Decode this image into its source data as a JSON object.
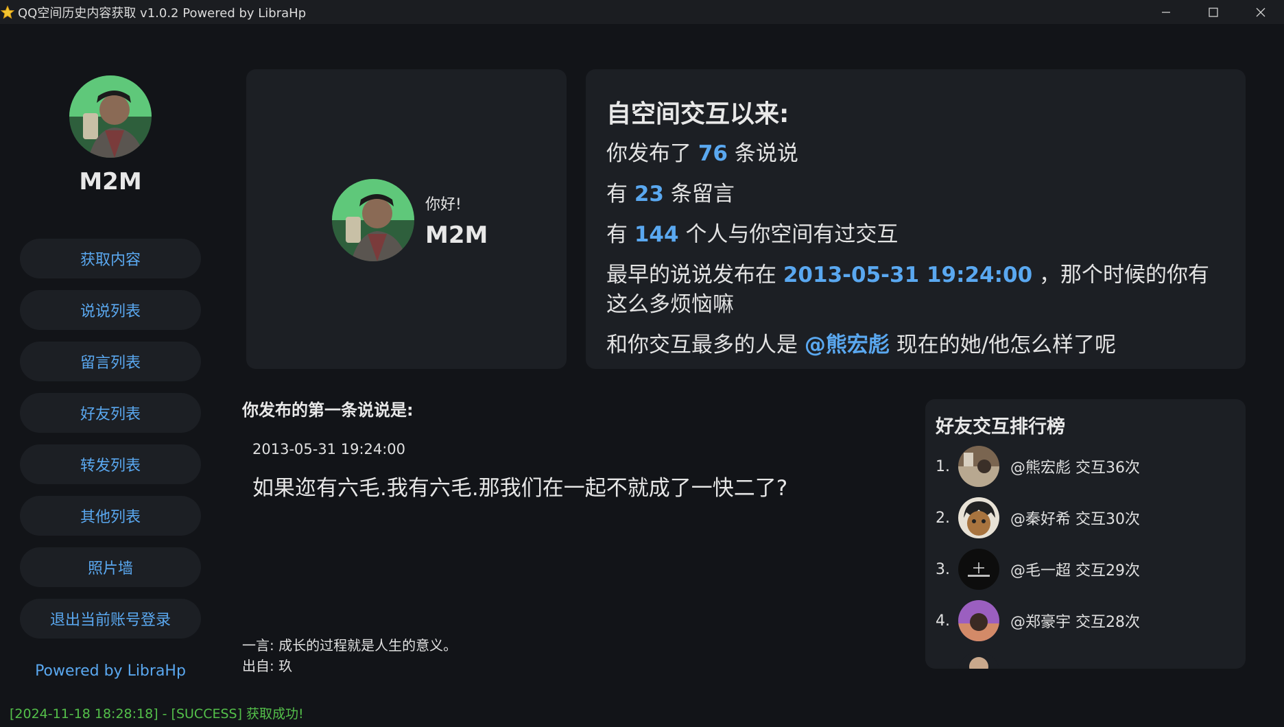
{
  "window": {
    "title": "QQ空间历史内容获取 v1.0.2 Powered by LibraHp"
  },
  "sidebar": {
    "name": "M2M",
    "items": [
      {
        "label": "获取内容"
      },
      {
        "label": "说说列表"
      },
      {
        "label": "留言列表"
      },
      {
        "label": "好友列表"
      },
      {
        "label": "转发列表"
      },
      {
        "label": "其他列表"
      },
      {
        "label": "照片墙"
      },
      {
        "label": "退出当前账号登录"
      }
    ],
    "powered": "Powered by LibraHp"
  },
  "greeting": {
    "hello": "你好!",
    "name": "M2M"
  },
  "stats": {
    "title": "自空间交互以来:",
    "posts_prefix": "你发布了",
    "posts_count": "76",
    "posts_suffix": "条说说",
    "messages_prefix": "有",
    "messages_count": "23",
    "messages_suffix": "条留言",
    "people_prefix": "有",
    "people_count": "144",
    "people_suffix": "个人与你空间有过交互",
    "earliest_prefix": "最早的说说发布在",
    "earliest_time": "2013-05-31 19:24:00",
    "earliest_suffix": "，那个时候的你有这么多烦恼嘛",
    "top_prefix": "和你交互最多的人是",
    "top_friend": "@熊宏彪",
    "top_suffix": "现在的她/他怎么样了呢"
  },
  "first_post": {
    "title": "你发布的第一条说说是:",
    "date": "2013-05-31 19:24:00",
    "content": "如果迩有六毛.我有六毛.那我们在一起不就成了一快二了?"
  },
  "quote": {
    "text": "一言: 成长的过程就是人生的意义。",
    "source": "出自: 玖"
  },
  "ranking": {
    "title": "好友交互排行榜",
    "items": [
      {
        "rank": "1.",
        "text": "@熊宏彪 交互36次"
      },
      {
        "rank": "2.",
        "text": "@秦好希 交互30次"
      },
      {
        "rank": "3.",
        "text": "@毛一超 交互29次"
      },
      {
        "rank": "4.",
        "text": "@郑豪宇 交互28次"
      }
    ]
  },
  "log": "[2024-11-18 18:28:18] - [SUCCESS] 获取成功!",
  "colors": {
    "accent": "#5aa8f0",
    "success": "#54c04a",
    "background": "#121418",
    "card": "#1c1f24"
  }
}
